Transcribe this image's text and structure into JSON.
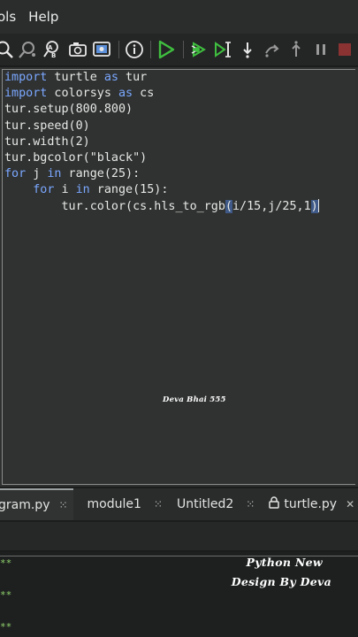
{
  "menu": {
    "tools": "ols",
    "help": "Help"
  },
  "toolbar": {
    "icons": [
      "search-icon",
      "replace-icon",
      "spellcheck-icon",
      "camera-icon",
      "screenshot-icon",
      "info-icon",
      "run-icon",
      "debug-icon",
      "step-over-icon",
      "step-into-icon",
      "step-out-icon",
      "resume-icon",
      "stop-icon"
    ],
    "run_color": "#3fbf3f",
    "stop_color": "#e04040"
  },
  "editor": {
    "lines": [
      {
        "kw": "import",
        "rest": " turtle ",
        "kw2": "as",
        "rest2": " tur"
      },
      {
        "kw": "import",
        "rest": " colorsys ",
        "kw2": "as",
        "rest2": " cs"
      },
      {
        "kw": "",
        "rest": "tur.setup(800.800)",
        "kw2": "",
        "rest2": ""
      },
      {
        "kw": "",
        "rest": "tur.speed(0)",
        "kw2": "",
        "rest2": ""
      },
      {
        "kw": "",
        "rest": "tur.width(2)",
        "kw2": "",
        "rest2": ""
      },
      {
        "kw": "",
        "rest": "tur.bgcolor(\"black\")",
        "kw2": "",
        "rest2": ""
      },
      {
        "kw": "for",
        "rest": " j ",
        "kw2": "in",
        "rest2": " range(25):"
      },
      {
        "kw": "    for",
        "rest": " i ",
        "kw2": "in",
        "rest2": " range(15):"
      }
    ],
    "last_line_prefix": "        tur.color(cs.hls_to_rgb",
    "last_line_open": "(",
    "last_line_body": "i/15,j/25,1",
    "last_line_close": ")",
    "watermark": "Deva Bhai 555"
  },
  "tabs": [
    {
      "label": "gram.py",
      "active": true,
      "closable": false
    },
    {
      "label": "module1",
      "active": false,
      "closable": false
    },
    {
      "label": "Untitled2",
      "active": false,
      "closable": false
    },
    {
      "label": "turtle.py",
      "active": false,
      "closable": true
    }
  ],
  "tab_close": "✕",
  "shell": {
    "prompts": [
      "**",
      "**",
      "**"
    ],
    "watermark_line1": "Python New",
    "watermark_line2": "Design By Deva"
  }
}
